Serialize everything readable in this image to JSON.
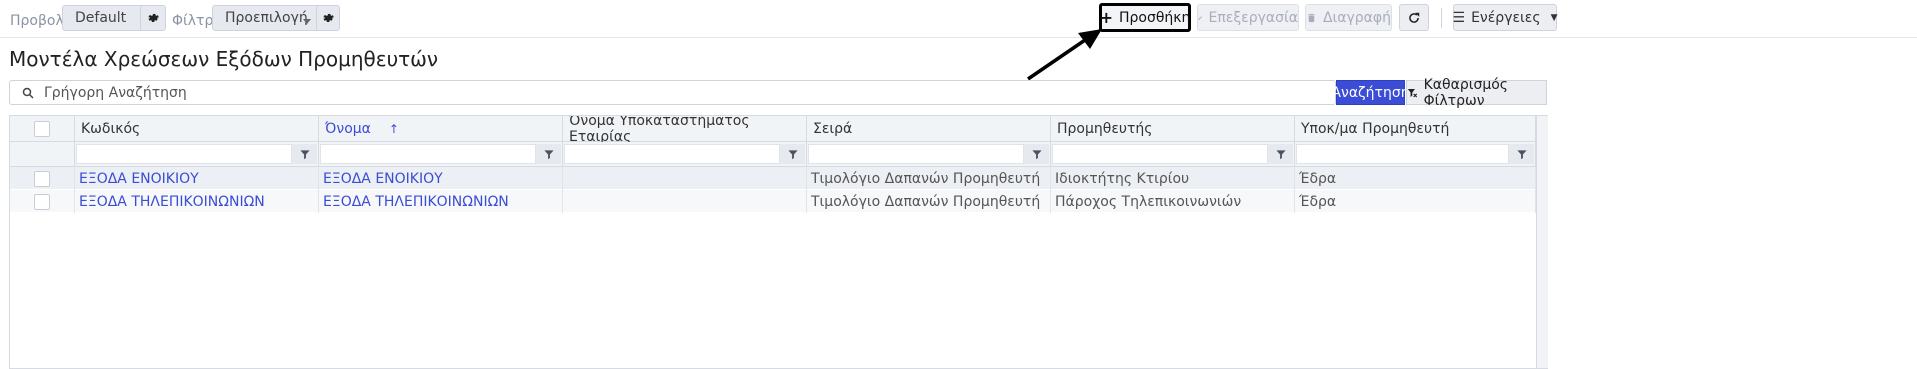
{
  "toolbar": {
    "view_label": "Προβολή",
    "view_value": "Default",
    "filters_label": "Φίλτρα",
    "filters_value": "Προεπιλογή",
    "add_label": "Προσθήκη",
    "edit_label": "Επεξεργασία",
    "delete_label": "Διαγραφή",
    "actions_label": "Ενέργειες"
  },
  "page": {
    "title": "Μοντέλα Χρεώσεων Εξόδων Προμηθευτών"
  },
  "search": {
    "placeholder": "Γρήγορη Αναζήτηση",
    "search_button": "Αναζήτηση",
    "clear_filters_button": "Καθαρισμός Φίλτρων"
  },
  "grid": {
    "columns": [
      "Κωδικός",
      "Όνομα",
      "Όνομα Υποκαταστήματος Εταιρίας",
      "Σειρά",
      "Προμηθευτής",
      "Υποκ/μα Προμηθευτή"
    ],
    "sort_indicator": "↑",
    "rows": [
      [
        "ΕΞΟΔΑ ΕΝΟΙΚΙΟΥ",
        "ΕΞΟΔΑ ΕΝΟΙΚΙΟΥ",
        "",
        "Τιμολόγιο Δαπανών Προμηθευτή",
        "Ιδιοκτήτης Κτιρίου",
        "Έδρα"
      ],
      [
        "ΕΞΟΔΑ ΤΗΛΕΠΙΚΟΙΝΩΝΙΩΝ",
        "ΕΞΟΔΑ ΤΗΛΕΠΙΚΟΙΝΩΝΙΩΝ",
        "",
        "Τιμολόγιο Δαπανών Προμηθευτή",
        "Πάροχος Τηλεπικοινωνιών",
        "Έδρα"
      ]
    ]
  }
}
